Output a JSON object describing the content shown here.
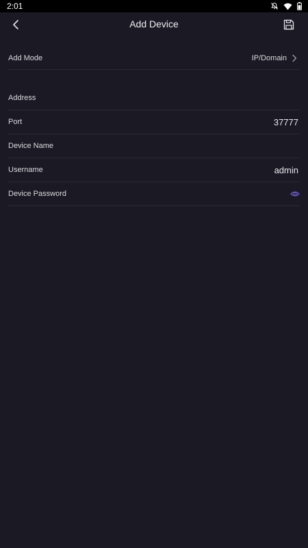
{
  "status_bar": {
    "time": "2:01",
    "icons": [
      "notifications-off-icon",
      "wifi-icon",
      "battery-icon"
    ]
  },
  "header": {
    "title": "Add Device",
    "back_icon": "back-chevron-icon",
    "save_icon": "save-icon"
  },
  "form": {
    "add_mode": {
      "label": "Add Mode",
      "value": "IP/Domain"
    },
    "address": {
      "label": "Address",
      "value": ""
    },
    "port": {
      "label": "Port",
      "value": "37777"
    },
    "device_name": {
      "label": "Device Name",
      "value": ""
    },
    "username": {
      "label": "Username",
      "value": "admin"
    },
    "device_password": {
      "label": "Device Password",
      "value": "",
      "reveal_icon": "eye-icon"
    }
  },
  "colors": {
    "background": "#1b1a24",
    "status_bar": "#000000",
    "divider": "#2a2935",
    "accent": "#6a5acd"
  }
}
